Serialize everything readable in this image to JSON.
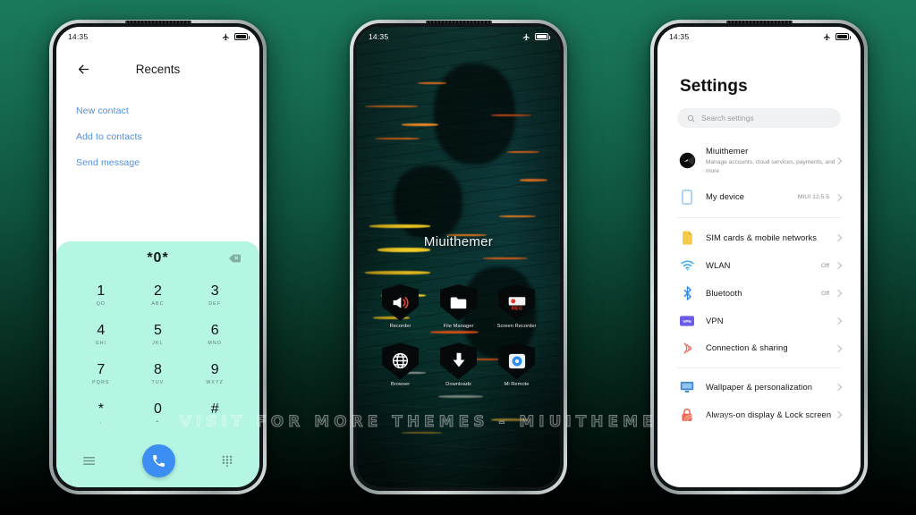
{
  "background": {
    "top_color": "#1b7a5c",
    "bottom_color": "#000000"
  },
  "watermark": {
    "text": "VISIT FOR MORE THEMES - MIUITHEMER.COM"
  },
  "phone_dialer": {
    "status_bar": {
      "time": "14:35",
      "airplane_icon": "airplane-mode-icon",
      "battery_icon": "battery-full-icon"
    },
    "header": {
      "back_icon": "back-arrow-icon",
      "title": "Recents"
    },
    "links": [
      {
        "label": "New contact"
      },
      {
        "label": "Add to contacts"
      },
      {
        "label": "Send message"
      }
    ],
    "keypad": {
      "entered_number": "*0*",
      "backspace_icon": "backspace-icon",
      "background_color": "#b4f5e3",
      "keys": [
        {
          "digit": "1",
          "sub": "QD"
        },
        {
          "digit": "2",
          "sub": "ABC"
        },
        {
          "digit": "3",
          "sub": "DEF"
        },
        {
          "digit": "4",
          "sub": "GHI"
        },
        {
          "digit": "5",
          "sub": "JKL"
        },
        {
          "digit": "6",
          "sub": "MNO"
        },
        {
          "digit": "7",
          "sub": "PQRS"
        },
        {
          "digit": "8",
          "sub": "TUV"
        },
        {
          "digit": "9",
          "sub": "WXYZ"
        },
        {
          "digit": "*",
          "sub": ","
        },
        {
          "digit": "0",
          "sub": "+"
        },
        {
          "digit": "#",
          "sub": ""
        }
      ],
      "dock": {
        "menu_icon": "hamburger-menu-icon",
        "call_icon": "phone-call-icon",
        "call_button_color": "#3d8ef2",
        "dialpad_icon": "dialpad-icon"
      }
    }
  },
  "phone_home": {
    "status_bar": {
      "time": "14:35",
      "airplane_icon": "airplane-mode-icon",
      "battery_icon": "battery-full-icon"
    },
    "wallpaper_label": "Miuithemer",
    "apps": [
      {
        "label": "Recorder",
        "icon": "megaphone-icon"
      },
      {
        "label": "File Manager",
        "icon": "folder-icon"
      },
      {
        "label": "Screen Recorder",
        "icon": "rec-record-icon"
      },
      {
        "label": "Browser",
        "icon": "globe-icon"
      },
      {
        "label": "Downloads",
        "icon": "download-arrow-icon"
      },
      {
        "label": "Mi Remote",
        "icon": "remote-control-icon"
      }
    ]
  },
  "phone_settings": {
    "status_bar": {
      "time": "14:35",
      "airplane_icon": "airplane-mode-icon",
      "battery_icon": "battery-full-icon"
    },
    "title": "Settings",
    "search": {
      "placeholder": "Search settings",
      "icon": "search-icon"
    },
    "account": {
      "name": "Miuithemer",
      "subtitle": "Manage accounts, cloud services, payments, and more",
      "avatar_icon": "avatar-icon",
      "chevron_icon": "chevron-right-icon"
    },
    "rows": [
      {
        "label": "My device",
        "value": "MIUI 12.5.5",
        "icon": "phone-device-icon",
        "icon_color": "#5aa9f0"
      },
      {
        "label": "SIM cards & mobile networks",
        "value": "",
        "icon": "sim-card-icon",
        "icon_color": "#f6c game"
      },
      {
        "label": "WLAN",
        "value": "Off",
        "icon": "wifi-icon",
        "icon_color": "#3da9f5"
      },
      {
        "label": "Bluetooth",
        "value": "Off",
        "icon": "bluetooth-icon",
        "icon_color": "#2f8df0"
      },
      {
        "label": "VPN",
        "value": "",
        "icon": "vpn-badge-icon",
        "icon_color": "#6b5ce7"
      },
      {
        "label": "Connection & sharing",
        "value": "",
        "icon": "connection-sharing-icon",
        "icon_color": "#ef5b4c"
      },
      {
        "label": "Wallpaper & personalization",
        "value": "",
        "icon": "monitor-wallpaper-icon",
        "icon_color": "#3b82d6"
      },
      {
        "label": "Always-on display & Lock screen",
        "value": "",
        "icon": "lock-icon",
        "icon_color": "#ef6b54"
      }
    ]
  }
}
